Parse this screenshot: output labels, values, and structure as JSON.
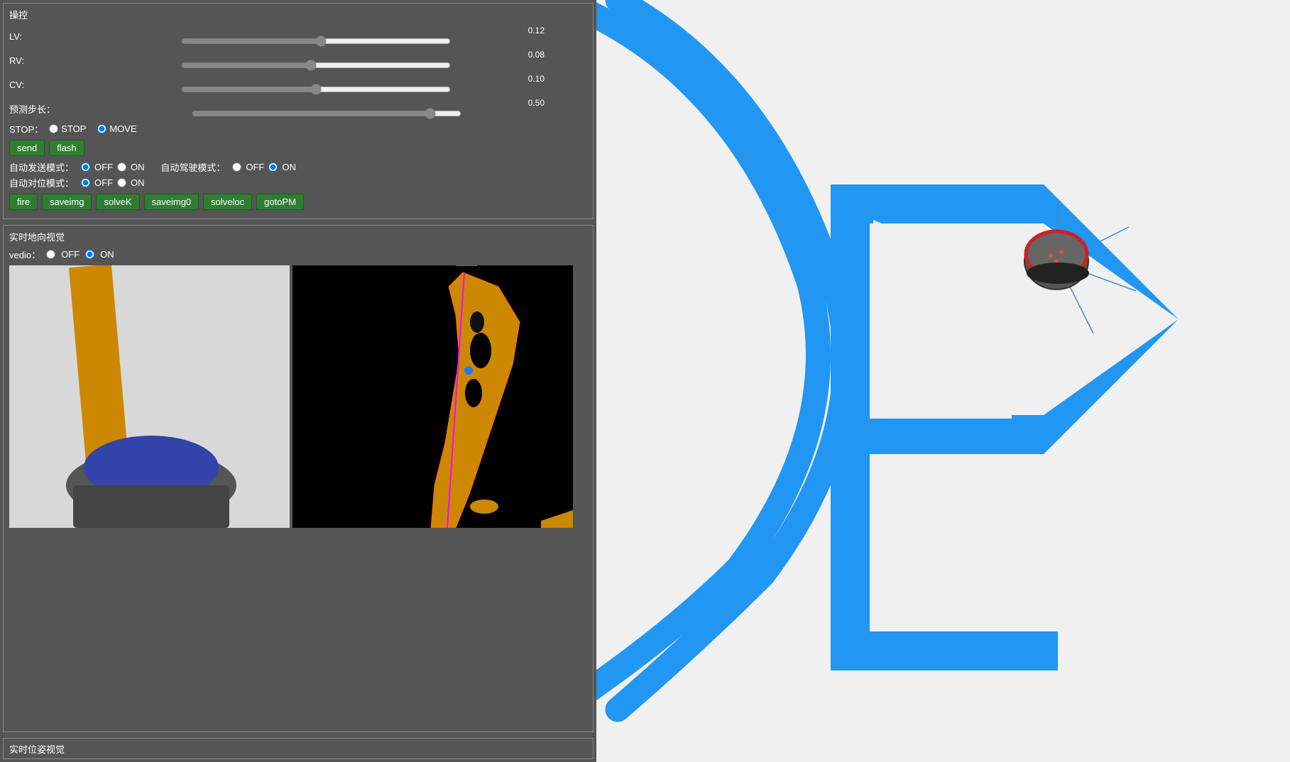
{
  "control": {
    "title": "操控",
    "lv_label": "LV:",
    "lv_value": "0.12",
    "lv_percent": 52,
    "rv_label": "RV:",
    "rv_value": "0.08",
    "rv_percent": 48,
    "cv_label": "CV:",
    "cv_value": "0.10",
    "cv_percent": 50,
    "predict_label": "预测步长：",
    "predict_value": "0.50",
    "predict_percent": 90,
    "stop_label": "STOP：",
    "stop_option": "STOP",
    "move_option": "MOVE",
    "stop_selected": false,
    "move_selected": true,
    "btn_send": "send",
    "btn_flash": "flash",
    "auto_send_label": "自动发送模式：",
    "off_label": "OFF",
    "on_label": "ON",
    "auto_drive_label": "自动驾驶模式：",
    "auto_pos_label": "自动对位模式：",
    "auto_send_off": true,
    "auto_send_on": false,
    "auto_drive_off": false,
    "auto_drive_on": true,
    "auto_pos_off": true,
    "auto_pos_on": false,
    "btn_fire": "fire",
    "btn_saveimg": "saveimg",
    "btn_solvek": "solveK",
    "btn_saveimg0": "saveimg0",
    "btn_solveloc": "solveloc",
    "btn_gotopm": "gotoPM"
  },
  "video": {
    "title": "实时地向视觉",
    "vedio_label": "vedio：",
    "vedio_off": "OFF",
    "vedio_on": "ON",
    "vedio_on_selected": true
  },
  "bottom": {
    "title": "实时位姿视觉"
  },
  "colors": {
    "green_btn": "#2e7d32",
    "panel_bg": "#555555",
    "accent_blue": "#2196f3"
  }
}
